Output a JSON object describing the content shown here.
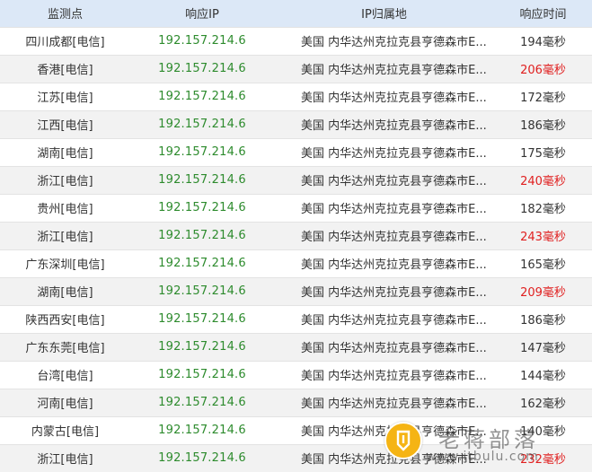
{
  "headers": {
    "node": "监测点",
    "ip": "响应IP",
    "location": "IP归属地",
    "time": "响应时间"
  },
  "rows": [
    {
      "node": "四川成都[电信]",
      "ip": "192.157.214.6",
      "location": "美国 内华达州克拉克县亨德森市E...",
      "time": "194毫秒"
    },
    {
      "node": "香港[电信]",
      "ip": "192.157.214.6",
      "location": "美国 内华达州克拉克县亨德森市E...",
      "time": "206毫秒"
    },
    {
      "node": "江苏[电信]",
      "ip": "192.157.214.6",
      "location": "美国 内华达州克拉克县亨德森市E...",
      "time": "172毫秒"
    },
    {
      "node": "江西[电信]",
      "ip": "192.157.214.6",
      "location": "美国 内华达州克拉克县亨德森市E...",
      "time": "186毫秒"
    },
    {
      "node": "湖南[电信]",
      "ip": "192.157.214.6",
      "location": "美国 内华达州克拉克县亨德森市E...",
      "time": "175毫秒"
    },
    {
      "node": "浙江[电信]",
      "ip": "192.157.214.6",
      "location": "美国 内华达州克拉克县亨德森市E...",
      "time": "240毫秒"
    },
    {
      "node": "贵州[电信]",
      "ip": "192.157.214.6",
      "location": "美国 内华达州克拉克县亨德森市E...",
      "time": "182毫秒"
    },
    {
      "node": "浙江[电信]",
      "ip": "192.157.214.6",
      "location": "美国 内华达州克拉克县亨德森市E...",
      "time": "243毫秒"
    },
    {
      "node": "广东深圳[电信]",
      "ip": "192.157.214.6",
      "location": "美国 内华达州克拉克县亨德森市E...",
      "time": "165毫秒"
    },
    {
      "node": "湖南[电信]",
      "ip": "192.157.214.6",
      "location": "美国 内华达州克拉克县亨德森市E...",
      "time": "209毫秒"
    },
    {
      "node": "陕西西安[电信]",
      "ip": "192.157.214.6",
      "location": "美国 内华达州克拉克县亨德森市E...",
      "time": "186毫秒"
    },
    {
      "node": "广东东莞[电信]",
      "ip": "192.157.214.6",
      "location": "美国 内华达州克拉克县亨德森市E...",
      "time": "147毫秒"
    },
    {
      "node": "台湾[电信]",
      "ip": "192.157.214.6",
      "location": "美国 内华达州克拉克县亨德森市E...",
      "time": "144毫秒"
    },
    {
      "node": "河南[电信]",
      "ip": "192.157.214.6",
      "location": "美国 内华达州克拉克县亨德森市E...",
      "time": "162毫秒"
    },
    {
      "node": "内蒙古[电信]",
      "ip": "192.157.214.6",
      "location": "美国 内华达州克拉克县亨德森市E...",
      "time": "140毫秒"
    },
    {
      "node": "浙江[电信]",
      "ip": "192.157.214.6",
      "location": "美国 内华达州克拉克县亨德森市E...",
      "time": "232毫秒"
    }
  ],
  "slow_threshold_ms": 200,
  "colors": {
    "header_bg": "#dce8f7",
    "ip_text": "#2d8b2d",
    "slow_time_text": "#e02020",
    "row_alt_bg": "#f2f2f2"
  },
  "watermark": {
    "title": "老蒋部落",
    "url": "www.itbulu.com",
    "icon": "pen-badge-icon"
  }
}
